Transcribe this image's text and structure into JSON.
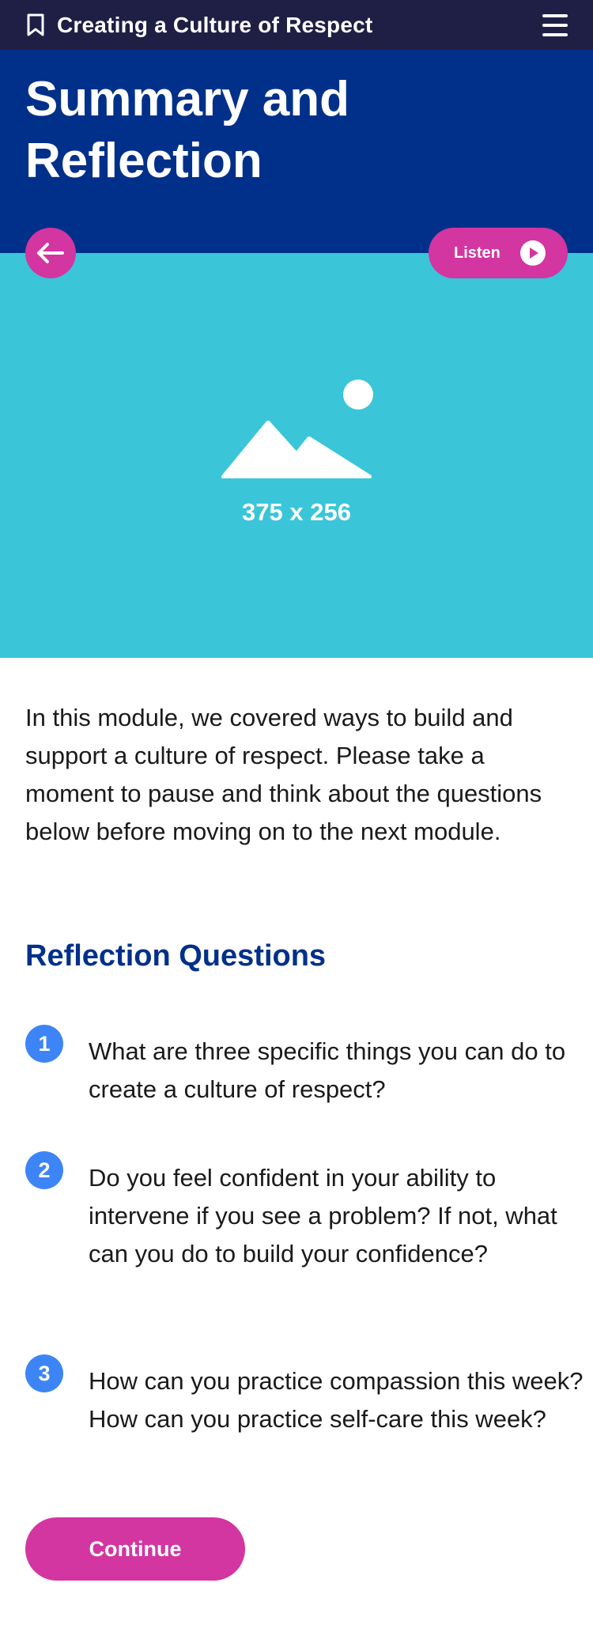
{
  "topbar": {
    "course_title": "Creating a Culture of Respect",
    "bookmark_icon": "bookmark-icon",
    "menu_icon": "hamburger-menu-icon"
  },
  "header": {
    "title": "Summary and Reflection"
  },
  "hero": {
    "back_icon": "arrow-left-icon",
    "listen_label": "Listen",
    "listen_icon": "play-icon",
    "placeholder_icon": "image-placeholder-icon",
    "placeholder_dims": "375 x 256"
  },
  "content": {
    "intro": "In this module, we covered ways to build and support a culture of respect. Please take a moment to pause and think about the questions below before moving on to the next module.",
    "section_title": "Reflection Questions",
    "questions": [
      {
        "num": "1",
        "text": "What are three specific things you can do to create a culture of respect?"
      },
      {
        "num": "2",
        "text": "Do you feel confident in your ability to intervene if you see a problem? If not, what can you do to build your confidence?"
      },
      {
        "num": "3",
        "text": "How can you practice compassion this week? How can you practice self-care this week?"
      }
    ],
    "continue_label": "Continue"
  },
  "colors": {
    "topbar": "#1f1f45",
    "header": "#00308a",
    "hero": "#3ac5d9",
    "accent": "#d335a1",
    "number_badge": "#3d85f6",
    "section_title": "#00308a"
  }
}
